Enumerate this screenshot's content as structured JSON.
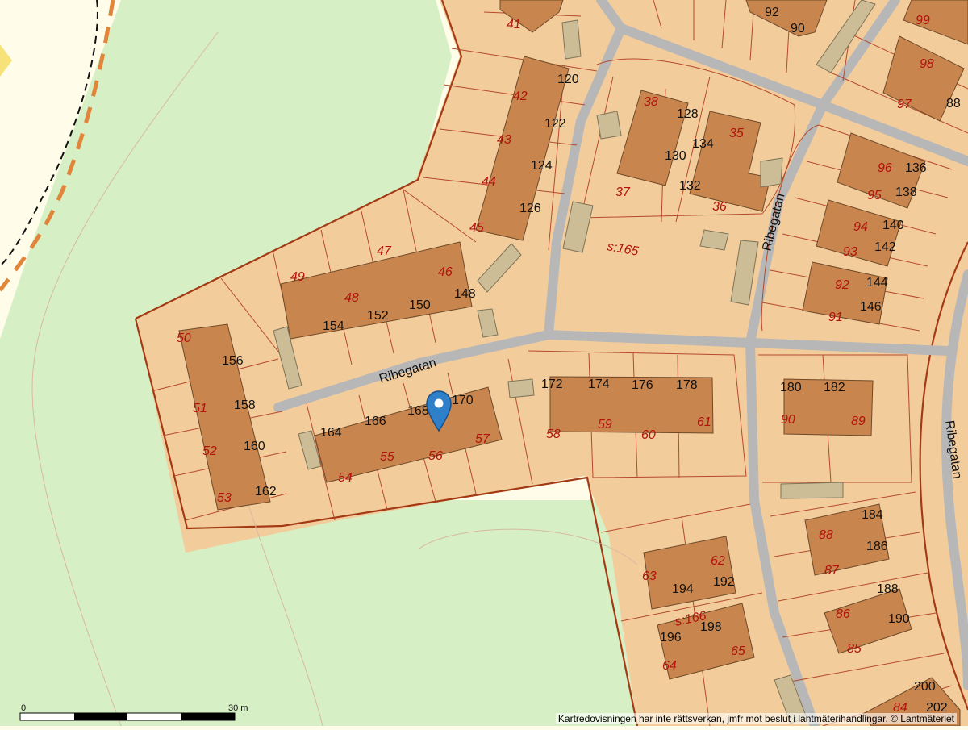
{
  "street_labels": {
    "ribegatan_west": "Ribegatan",
    "ribegatan_north": "Ribegatan",
    "ribegatan_east": "Ribegatan"
  },
  "area_labels": {
    "s165": "s:165",
    "s166": "s:166"
  },
  "parcel_numbers": [
    "41",
    "42",
    "43",
    "44",
    "45",
    "46",
    "47",
    "48",
    "49",
    "50",
    "51",
    "52",
    "53",
    "54",
    "55",
    "56",
    "57",
    "58",
    "59",
    "60",
    "61",
    "62",
    "63",
    "64",
    "65",
    "35",
    "36",
    "37",
    "38",
    "84",
    "85",
    "86",
    "87",
    "88",
    "89",
    "90",
    "91",
    "92",
    "93",
    "94",
    "95",
    "96",
    "97",
    "98",
    "99"
  ],
  "address_numbers": [
    "90",
    "92",
    "120",
    "122",
    "124",
    "126",
    "128",
    "130",
    "132",
    "134",
    "136",
    "138",
    "140",
    "142",
    "144",
    "146",
    "148",
    "150",
    "152",
    "154",
    "156",
    "158",
    "160",
    "162",
    "164",
    "166",
    "168",
    "170",
    "172",
    "174",
    "176",
    "178",
    "180",
    "182",
    "184",
    "186",
    "188",
    "190",
    "192",
    "194",
    "196",
    "198",
    "200",
    "202",
    "88"
  ],
  "scale": {
    "min_label": "0",
    "max_label": "30 m"
  },
  "attribution": "Kartredovisningen har inte rättsverkan, jmfr mot beslut i lantmäterihandlingar. © Lantmäteriet",
  "marker": {
    "label": "location-marker",
    "color": "#2f80c8"
  },
  "colors": {
    "forest": "#d6efc4",
    "residential": "#f3cc9c",
    "building": "#c8864e",
    "boundary": "#a33a14",
    "road": "#b7b7b7",
    "open": "#fffde9"
  }
}
